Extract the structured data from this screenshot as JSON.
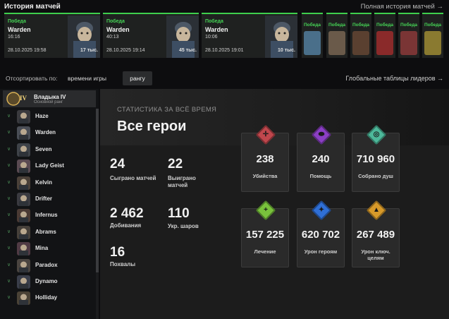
{
  "header": {
    "title": "История матчей",
    "full_history_link": "Полная история матчей →"
  },
  "recent_matches": [
    {
      "result": "Победа",
      "hero": "Warden",
      "duration": "16:16",
      "date": "28.10.2025 19:58",
      "souls": "17 тыс."
    },
    {
      "result": "Победа",
      "hero": "Warden",
      "duration": "40:13",
      "date": "28.10.2025 19:14",
      "souls": "45 тыс."
    },
    {
      "result": "Победа",
      "hero": "Warden",
      "duration": "10:06",
      "date": "28.10.2025 19:01",
      "souls": "10 тыс."
    }
  ],
  "older_matches": [
    {
      "result": "Победа",
      "color": "#4a6f8a"
    },
    {
      "result": "Победа",
      "color": "#6a5a4a"
    },
    {
      "result": "Победа",
      "color": "#5a4030"
    },
    {
      "result": "Победа",
      "color": "#8a2a2a"
    },
    {
      "result": "Победа",
      "color": "#7a3535"
    },
    {
      "result": "Победа",
      "color": "#8a7a30"
    }
  ],
  "sort": {
    "label": "Отсортировать по:",
    "option_time": "времени игры",
    "option_rank": "рангу"
  },
  "leaderboard_link": "Глобальные таблицы лидеров →",
  "rank": {
    "badge": "IV",
    "name": "Владыка IV",
    "subtitle": "Основной ранг"
  },
  "heroes": [
    {
      "name": "Haze",
      "color": "#3a3a3e"
    },
    {
      "name": "Warden",
      "color": "#4a4e56"
    },
    {
      "name": "Seven",
      "color": "#3e4248"
    },
    {
      "name": "Lady Geist",
      "color": "#5a4a52"
    },
    {
      "name": "Kelvin",
      "color": "#4a4038"
    },
    {
      "name": "Drifter",
      "color": "#3a3a40"
    },
    {
      "name": "Infernus",
      "color": "#4a3a34"
    },
    {
      "name": "Abrams",
      "color": "#46403a"
    },
    {
      "name": "Mina",
      "color": "#503a44"
    },
    {
      "name": "Paradox",
      "color": "#4a4440"
    },
    {
      "name": "Dynamo",
      "color": "#3a3e4a"
    },
    {
      "name": "Holliday",
      "color": "#4a4236"
    }
  ],
  "stats_panel": {
    "subtitle": "СТАТИСТИКА ЗА ВСЁ ВРЕМЯ",
    "title": "Все герои",
    "general": [
      {
        "value": "24",
        "label": "Сыграно матчей"
      },
      {
        "value": "22",
        "label": "Выиграно матчей"
      },
      {
        "value": "2 462",
        "label": "Добивания"
      },
      {
        "value": "110",
        "label": "Укр. шаров"
      },
      {
        "value": "16",
        "label": "Похвалы"
      }
    ],
    "cards": [
      {
        "value": "238",
        "label": "Убийства",
        "icon": "crosshair-icon",
        "color": "#c0474d"
      },
      {
        "value": "240",
        "label": "Помощь",
        "icon": "handshake-icon",
        "color": "#8b3fc4"
      },
      {
        "value": "710 960",
        "label": "Собрано душ",
        "icon": "soul-icon",
        "color": "#4db89a"
      },
      {
        "value": "157 225",
        "label": "Лечение",
        "icon": "plus-icon",
        "color": "#79c23c"
      },
      {
        "value": "620 702",
        "label": "Урон героям",
        "icon": "damage-icon",
        "color": "#2f6fd6"
      },
      {
        "value": "267 489",
        "label": "Урон ключ. целям",
        "icon": "objective-icon",
        "color": "#d89a2a"
      }
    ]
  }
}
